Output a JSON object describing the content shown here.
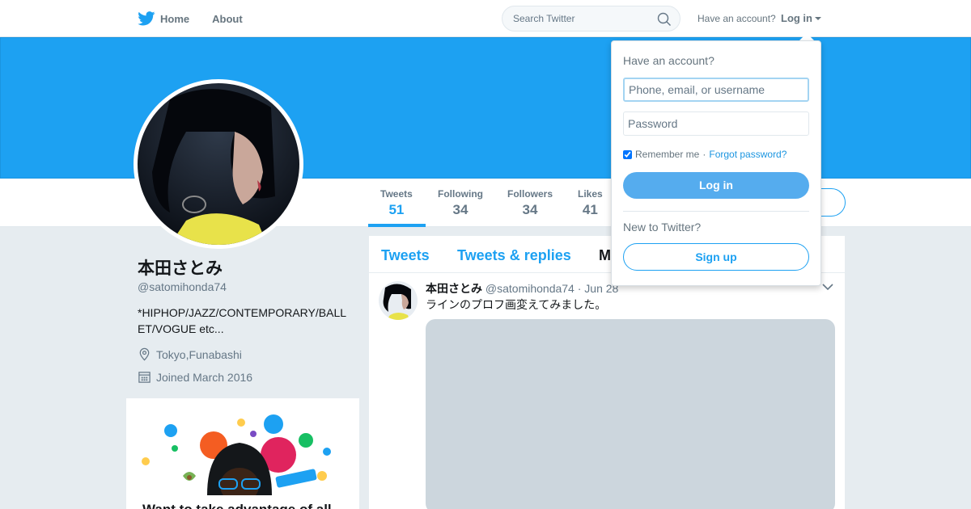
{
  "nav": {
    "home_label": "Home",
    "about_label": "About",
    "search_placeholder": "Search Twitter",
    "have_account": "Have an account?",
    "login_label": "Log in"
  },
  "colors": {
    "brand": "#1da1f2",
    "banner": "#1da1f2",
    "media_placeholder": "#ccd6dd"
  },
  "profile": {
    "name": "本田さとみ",
    "handle": "@satomihonda74",
    "bio": "*HIPHOP/JAZZ/CONTEMPORARY/BALLET/VOGUE etc...",
    "location": "Tokyo,Funabashi",
    "joined": "Joined March 2016"
  },
  "stats": [
    {
      "label": "Tweets",
      "value": "51"
    },
    {
      "label": "Following",
      "value": "34"
    },
    {
      "label": "Followers",
      "value": "34"
    },
    {
      "label": "Likes",
      "value": "41"
    }
  ],
  "promo": {
    "text": "Want to take advantage of all"
  },
  "timeline": {
    "tabs": [
      "Tweets",
      "Tweets & replies",
      "M"
    ],
    "tweet": {
      "name": "本田さとみ",
      "handle": "@satomihonda74",
      "separator": "·",
      "date": "Jun 28",
      "text": "ラインのプロフ画変えてみました。"
    }
  },
  "login_dropdown": {
    "title": "Have an account?",
    "username_placeholder": "Phone, email, or username",
    "password_placeholder": "Password",
    "remember_label": "Remember me",
    "separator": "·",
    "forgot_label": "Forgot password?",
    "login_button": "Log in",
    "new_label": "New to Twitter?",
    "signup_button": "Sign up"
  },
  "icons": [
    "twitter-bird-icon",
    "search-icon",
    "caret-down-icon",
    "location-icon",
    "calendar-icon",
    "chevron-down-icon"
  ]
}
